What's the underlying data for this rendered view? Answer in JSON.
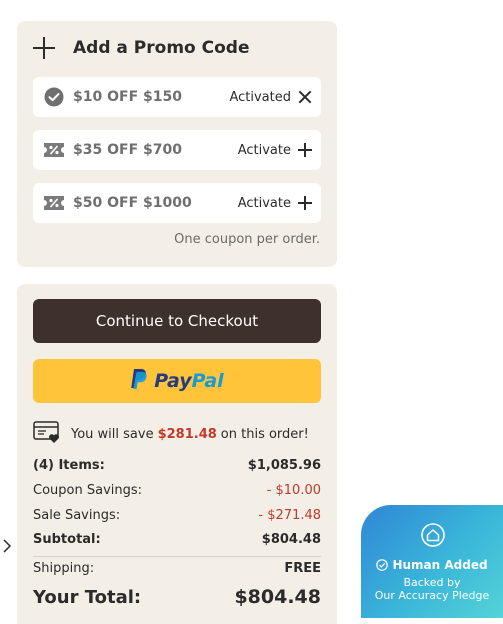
{
  "promo": {
    "title": "Add a Promo Code",
    "coupons": [
      {
        "name": "$10 OFF $150",
        "state": "Activated",
        "action_icon": "close-icon",
        "active": true
      },
      {
        "name": "$35 OFF $700",
        "state": "Activate",
        "action_icon": "plus-icon",
        "active": false
      },
      {
        "name": "$50 OFF $1000",
        "state": "Activate",
        "action_icon": "plus-icon",
        "active": false
      }
    ],
    "note": "One coupon per order."
  },
  "checkout": {
    "continue_label": "Continue to Checkout",
    "paypal_pay": "Pay",
    "paypal_pal": "Pal",
    "save_prefix": "You will save",
    "save_amount": "$281.48",
    "save_suffix": "on this order!"
  },
  "summary": {
    "items_label": "(4) Items:",
    "items_value": "$1,085.96",
    "coupon_label": "Coupon Savings:",
    "coupon_value": "- $10.00",
    "sale_label": "Sale Savings:",
    "sale_value": "- $271.48",
    "subtotal_label": "Subtotal:",
    "subtotal_value": "$804.48",
    "shipping_label": "Shipping:",
    "shipping_value": "FREE",
    "total_label": "Your Total:",
    "total_value": "$804.48"
  },
  "badge": {
    "title": "Human Added",
    "line1": "Backed by",
    "line2": "Our Accuracy Pledge"
  },
  "colors": {
    "panel_bg": "#f4efe6",
    "checkout_btn": "#3e302b",
    "paypal_btn": "#ffc439",
    "savings_red": "#c0392b"
  }
}
